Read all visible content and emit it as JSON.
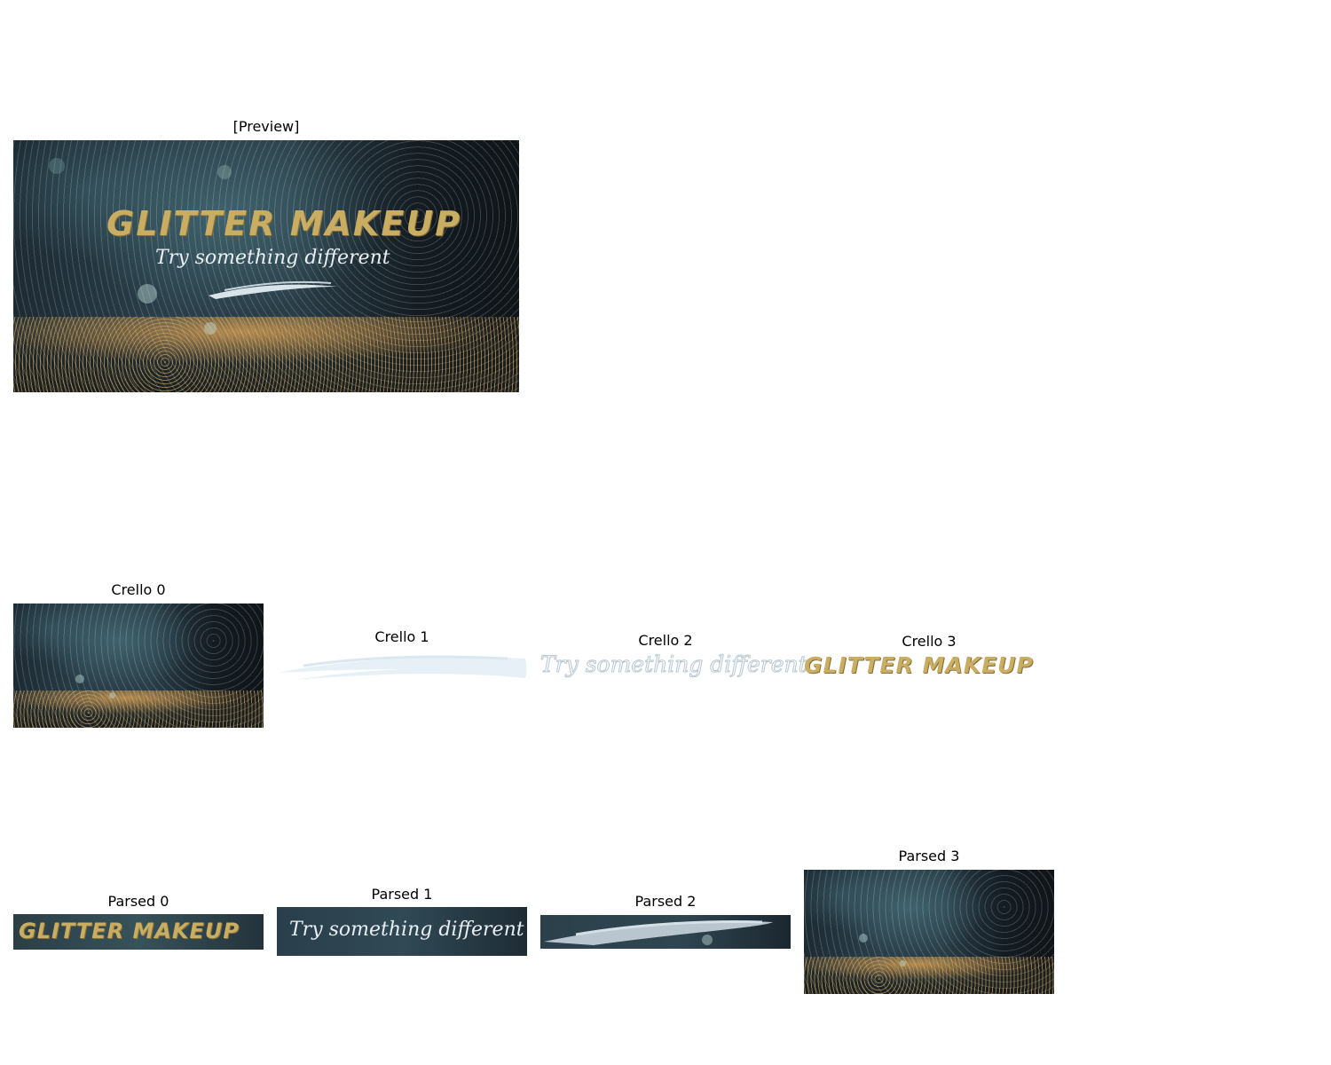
{
  "preview": {
    "caption": "[Preview]",
    "headline": "GLITTER MAKEUP",
    "tagline": "Try something different"
  },
  "crello": [
    {
      "caption": "Crello 0"
    },
    {
      "caption": "Crello 1"
    },
    {
      "caption": "Crello 2",
      "text": "Try something different"
    },
    {
      "caption": "Crello 3",
      "text": "GLITTER MAKEUP"
    }
  ],
  "parsed": [
    {
      "caption": "Parsed 0",
      "text": "GLITTER MAKEUP"
    },
    {
      "caption": "Parsed 1",
      "text": "Try something different"
    },
    {
      "caption": "Parsed 2"
    },
    {
      "caption": "Parsed 3"
    }
  ],
  "colors": {
    "gold_text": "#c9ad62",
    "script_text": "#e8eef2",
    "stroke_light": "#e6f0f6",
    "background": "#ffffff"
  }
}
